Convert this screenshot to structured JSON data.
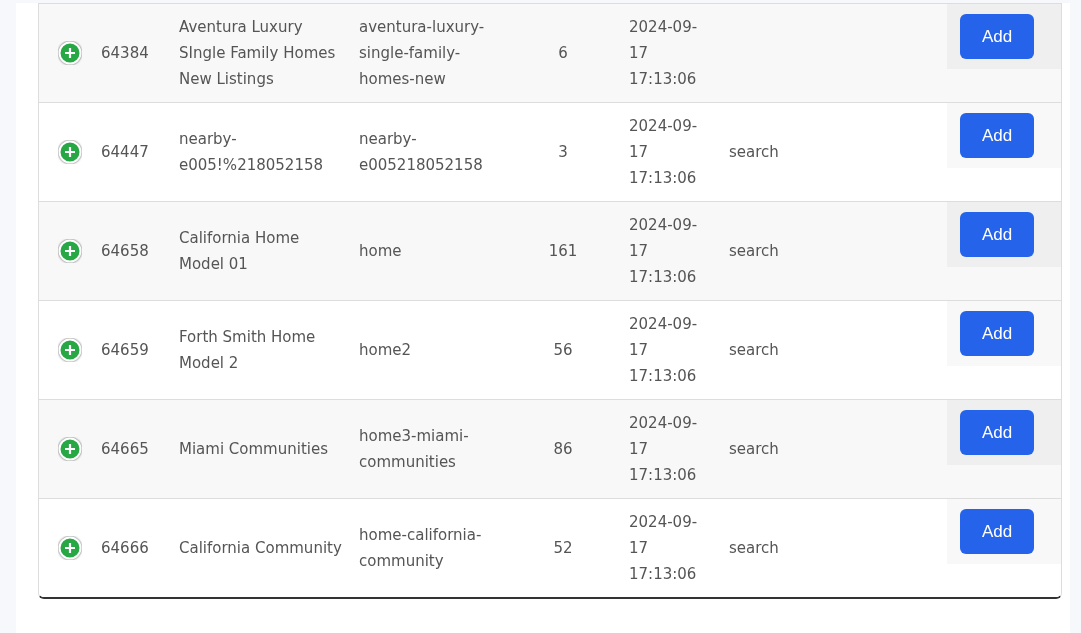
{
  "rows": [
    {
      "id": "64384",
      "name": "Aventura Luxury SIngle Family Homes New Listings",
      "slug": "aventura-luxury-single-family-homes-new",
      "count": "6",
      "date": "2024-09-17 17:13:06",
      "button": "Add"
    },
    {
      "id": "64447",
      "name": "nearby-e005!%218052158",
      "slug": "nearby-e005218052158",
      "count": "3",
      "date": "2024-09-17 17:13:06",
      "type": "search",
      "button": "Add"
    },
    {
      "id": "64658",
      "name": "California Home Model 01",
      "slug": "home",
      "count": "161",
      "date": "2024-09-17 17:13:06",
      "type": "search",
      "button": "Add"
    },
    {
      "id": "64659",
      "name": "Forth Smith Home Model 2",
      "slug": "home2",
      "count": "56",
      "date": "2024-09-17 17:13:06",
      "type": "search",
      "button": "Add"
    },
    {
      "id": "64665",
      "name": "Miami Communities",
      "slug": "home3-miami-communities",
      "count": "86",
      "date": "2024-09-17 17:13:06",
      "type": "search",
      "button": "Add"
    },
    {
      "id": "64666",
      "name": "California Community",
      "slug": "home-california-community",
      "count": "52",
      "date": "2024-09-17 17:13:06",
      "type": "search",
      "button": "Add"
    }
  ]
}
